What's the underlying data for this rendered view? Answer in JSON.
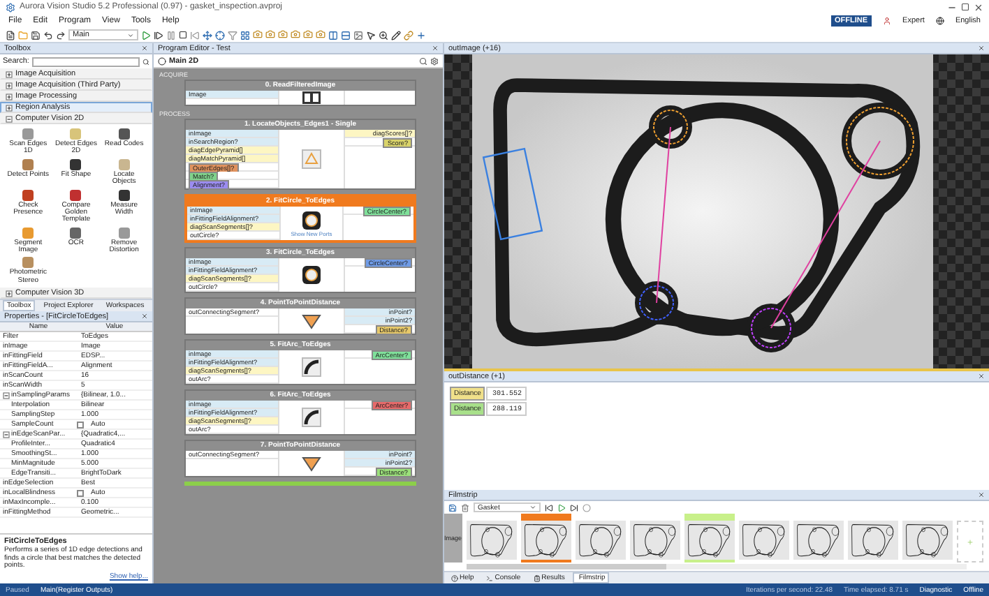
{
  "window": {
    "title": "Aurora Vision Studio 5.2 Professional (0.97) - gasket_inspection.avproj"
  },
  "menu": [
    {
      "label": "File"
    },
    {
      "label": "Edit"
    },
    {
      "label": "Program"
    },
    {
      "label": "View"
    },
    {
      "label": "Tools"
    },
    {
      "label": "Help"
    }
  ],
  "account": {
    "status": "OFFLINE",
    "mode": "Expert",
    "language": "English"
  },
  "toolbar": {
    "program": "Main"
  },
  "toolbox": {
    "title": "Toolbox",
    "search_label": "Search:",
    "categories": [
      {
        "label": "Image Acquisition",
        "expanded": false,
        "selected": false
      },
      {
        "label": "Image Acquisition (Third Party)",
        "expanded": false,
        "selected": false
      },
      {
        "label": "Image Processing",
        "expanded": false,
        "selected": false
      },
      {
        "label": "Region Analysis",
        "expanded": false,
        "selected": true
      },
      {
        "label": "Computer Vision 2D",
        "expanded": true,
        "selected": false,
        "tools": [
          {
            "label": "Scan Edges 1D",
            "kind": "scan"
          },
          {
            "label": "Detect Edges 2D",
            "kind": "edges"
          },
          {
            "label": "Read Codes",
            "kind": "codes"
          },
          {
            "label": "Detect Points",
            "kind": "points"
          },
          {
            "label": "Fit Shape",
            "kind": "fit"
          },
          {
            "label": "Locate Objects",
            "kind": "locate"
          },
          {
            "label": "Check Presence",
            "kind": "presence"
          },
          {
            "label": "Compare Golden Template",
            "kind": "template"
          },
          {
            "label": "Measure Width",
            "kind": "width"
          },
          {
            "label": "Segment Image",
            "kind": "segment"
          },
          {
            "label": "OCR",
            "kind": "ocr"
          },
          {
            "label": "Remove Distortion",
            "kind": "distortion"
          },
          {
            "label": "Photometric Stereo",
            "kind": "stereo"
          }
        ]
      },
      {
        "label": "Computer Vision 3D",
        "expanded": false,
        "selected": false
      }
    ]
  },
  "left_tabs": [
    {
      "label": "Toolbox",
      "selected": true
    },
    {
      "label": "Project Explorer",
      "selected": false
    },
    {
      "label": "Workspaces",
      "selected": false
    }
  ],
  "properties": {
    "title": "Properties - [FitCircleToEdges]",
    "columns": [
      "Name",
      "Value"
    ],
    "filter": {
      "label": "Filter",
      "value": "ToEdges"
    },
    "rows": [
      {
        "name": "inImage",
        "value": "Image"
      },
      {
        "name": "inFittingField",
        "value": "EDSP..."
      },
      {
        "name": "inFittingFieldA...",
        "value": "Alignment"
      },
      {
        "name": "inScanCount",
        "value": "16"
      },
      {
        "name": "inScanWidth",
        "value": "5"
      },
      {
        "name": "inSamplingParams",
        "value": "{Bilinear, 1.0...",
        "expanded": true,
        "children": [
          {
            "name": "Interpolation",
            "value": "Bilinear"
          },
          {
            "name": "SamplingStep",
            "value": "1.000"
          },
          {
            "name": "SampleCount",
            "value": "Auto",
            "kind": "checkbox",
            "checked": false
          }
        ]
      },
      {
        "name": "inEdgeScanPar...",
        "value": "{Quadratic4,...",
        "expanded": true,
        "children": [
          {
            "name": "ProfileInter...",
            "value": "Quadratic4"
          },
          {
            "name": "SmoothingSt...",
            "value": "1.000"
          },
          {
            "name": "MinMagnitude",
            "value": "5.000"
          },
          {
            "name": "EdgeTransiti...",
            "value": "BrightToDark"
          }
        ]
      },
      {
        "name": "inEdgeSelection",
        "value": "Best"
      },
      {
        "name": "inLocalBlindness",
        "value": "Auto",
        "kind": "checkbox",
        "checked": false
      },
      {
        "name": "inMaxIncomple...",
        "value": "0.100"
      },
      {
        "name": "inFittingMethod",
        "value": "Geometric..."
      }
    ]
  },
  "description": {
    "title": "FitCircleToEdges",
    "text": "Performs a series of 1D edge detections and finds a circle that best matches the detected points.",
    "link": "Show help..."
  },
  "editor": {
    "title": "Program Editor - Test",
    "program": "Main 2D",
    "sections": [
      {
        "label": "ACQUIRE",
        "blocks": [
          {
            "title": "0. ReadFilteredImage",
            "kind": "read",
            "selected": false,
            "inputs": [
              {
                "label": "Image",
                "kind": "input"
              }
            ]
          }
        ]
      },
      {
        "label": "PROCESS",
        "blocks": [
          {
            "title": "1. LocateObjects_Edges1 - Single",
            "kind": "locate",
            "selected": false,
            "inputs": [
              {
                "label": "inImage",
                "kind": "input"
              },
              {
                "label": "inSearchRegion?",
                "kind": "input"
              },
              {
                "label": "diagEdgePyramid[]",
                "kind": "diagnostic"
              },
              {
                "label": "diagMatchPyramid[]",
                "kind": "diagnostic"
              },
              {
                "label": "OuterEdges[]?",
                "kind": "tag",
                "color": "#e0925e"
              },
              {
                "label": "Match?",
                "kind": "tag",
                "color": "#7fd18b"
              },
              {
                "label": "Alignment?",
                "kind": "tag",
                "color": "#9b8cf0"
              }
            ],
            "outputs": [
              {
                "label": "diagScores[]?",
                "kind": "diagnostic"
              },
              {
                "label": "Score?",
                "kind": "tag",
                "color": "#d9d36a"
              }
            ]
          },
          {
            "title": "2. FitCircle_ToEdges",
            "kind": "circle",
            "selected": true,
            "caption": "Show New Ports",
            "inputs": [
              {
                "label": "inImage",
                "kind": "input"
              },
              {
                "label": "inFittingFieldAlignment?",
                "kind": "input"
              },
              {
                "label": "diagScanSegments[]?",
                "kind": "diagnostic"
              },
              {
                "label": "outCircle?",
                "kind": "output"
              }
            ],
            "outputs": [
              {
                "label": "CircleCenter?",
                "kind": "tag",
                "color": "#7fe09a"
              }
            ]
          },
          {
            "title": "3. FitCircle_ToEdges",
            "kind": "circle",
            "selected": false,
            "inputs": [
              {
                "label": "inImage",
                "kind": "input"
              },
              {
                "label": "inFittingFieldAlignment?",
                "kind": "input"
              },
              {
                "label": "diagScanSegments[]?",
                "kind": "diagnostic"
              },
              {
                "label": "outCircle?",
                "kind": "output"
              }
            ],
            "outputs": [
              {
                "label": "CircleCenter?",
                "kind": "tag",
                "color": "#6f9be6"
              }
            ]
          },
          {
            "title": "4. PointToPointDistance",
            "kind": "distance",
            "selected": false,
            "inputs": [
              {
                "label": "outConnectingSegment?",
                "kind": "output"
              }
            ],
            "outputs": [
              {
                "label": "inPoint?",
                "kind": "input"
              },
              {
                "label": "inPoint2?",
                "kind": "input"
              },
              {
                "label": "Distance?",
                "kind": "tag",
                "color": "#e6c86a"
              }
            ]
          },
          {
            "title": "5. FitArc_ToEdges",
            "kind": "arc",
            "selected": false,
            "inputs": [
              {
                "label": "inImage",
                "kind": "input"
              },
              {
                "label": "inFittingFieldAlignment?",
                "kind": "input"
              },
              {
                "label": "diagScanSegments[]?",
                "kind": "diagnostic"
              },
              {
                "label": "outArc?",
                "kind": "output"
              }
            ],
            "outputs": [
              {
                "label": "ArcCenter?",
                "kind": "tag",
                "color": "#7fe09a"
              }
            ]
          },
          {
            "title": "6. FitArc_ToEdges",
            "kind": "arc",
            "selected": false,
            "inputs": [
              {
                "label": "inImage",
                "kind": "input"
              },
              {
                "label": "inFittingFieldAlignment?",
                "kind": "input"
              },
              {
                "label": "diagScanSegments[]?",
                "kind": "diagnostic"
              },
              {
                "label": "outArc?",
                "kind": "output"
              }
            ],
            "outputs": [
              {
                "label": "ArcCenter?",
                "kind": "tag",
                "color": "#e66a6a"
              }
            ]
          },
          {
            "title": "7. PointToPointDistance",
            "kind": "distance",
            "selected": false,
            "inputs": [
              {
                "label": "outConnectingSegment?",
                "kind": "output"
              }
            ],
            "outputs": [
              {
                "label": "inPoint?",
                "kind": "input"
              },
              {
                "label": "inPoint2?",
                "kind": "input"
              },
              {
                "label": "Distance?",
                "kind": "tag",
                "color": "#9be07a"
              }
            ]
          }
        ]
      }
    ]
  },
  "viewer": {
    "title": "outImage (+16)"
  },
  "results": {
    "title": "outDistance (+1)",
    "rows": [
      {
        "label": "Distance",
        "color": "#f0e08a",
        "value": "301.552"
      },
      {
        "label": "Distance",
        "color": "#a8e08a",
        "value": "288.119"
      }
    ]
  },
  "filmstrip": {
    "title": "Filmstrip",
    "sequence": "Gasket",
    "row_label": "Image",
    "frames": [
      {
        "highlight": false
      },
      {
        "highlight": true,
        "color": "#f07a1e"
      },
      {
        "highlight": false
      },
      {
        "highlight": false
      },
      {
        "highlight": true,
        "color": "#c8f08a"
      },
      {
        "highlight": false
      },
      {
        "highlight": false
      },
      {
        "highlight": false
      },
      {
        "highlight": false
      }
    ]
  },
  "bottom_tabs": [
    {
      "label": "Help",
      "selected": false
    },
    {
      "label": "Console",
      "selected": false
    },
    {
      "label": "Results",
      "selected": false
    },
    {
      "label": "Filmstrip",
      "selected": true
    }
  ],
  "status_bar": {
    "state": "Paused",
    "location": "Main(Register Outputs)",
    "iterations": "Iterations per second: 22.48",
    "elapsed": "Time elapsed: 8.71 s",
    "mode": "Diagnostic",
    "connection": "Offline"
  }
}
